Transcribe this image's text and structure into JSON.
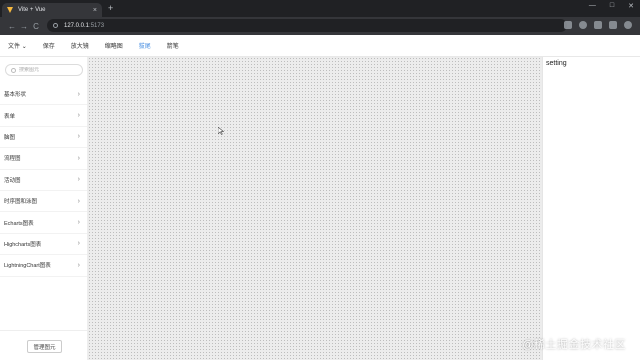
{
  "browser": {
    "tab_title": "Vite + Vue",
    "tab_close": "×",
    "new_tab": "+",
    "url_host": "127.0.0.1",
    "url_port": ":5173",
    "nav": {
      "back": "←",
      "forward": "→",
      "reload": "C"
    },
    "window_controls": {
      "minimize": "—",
      "maximize": "□",
      "close": "✕"
    }
  },
  "menu": {
    "items": [
      {
        "label": "文件"
      },
      {
        "label": "保存"
      },
      {
        "label": "放大镜"
      },
      {
        "label": "缩略图"
      },
      {
        "label": "拔尾"
      },
      {
        "label": "箭笔"
      }
    ],
    "file_chevron": "⌄"
  },
  "sidebar": {
    "search_placeholder": "搜索图元",
    "categories": [
      {
        "label": "基本形状"
      },
      {
        "label": "表单"
      },
      {
        "label": "脑图"
      },
      {
        "label": "流程图"
      },
      {
        "label": "活动图"
      },
      {
        "label": "时序图和泳图"
      },
      {
        "label": "Echarts图表"
      },
      {
        "label": "Highcharts图表"
      },
      {
        "label": "LightningChart图表"
      }
    ],
    "arrow": "›",
    "manage_button": "管理图元"
  },
  "settings": {
    "title": "setting"
  },
  "watermark": "@稀土掘金技术社区",
  "colors": {
    "active_menu": "#4a90e2",
    "canvas_bg": "#ececec",
    "chrome_dark": "#202124"
  }
}
